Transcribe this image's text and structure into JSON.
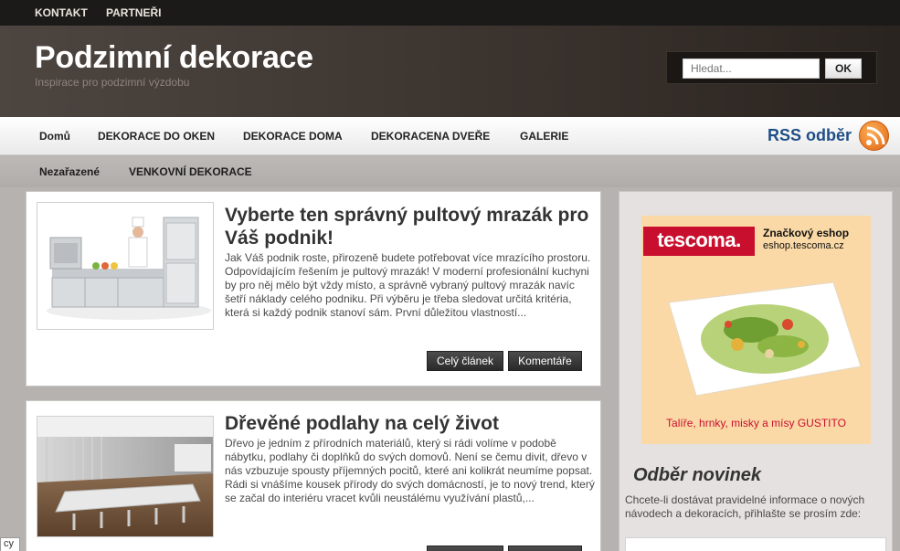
{
  "topnav": {
    "items": [
      "KONTAKT",
      "PARTNEŘI"
    ]
  },
  "header": {
    "title": "Podzimní dekorace",
    "tagline": "Inspirace pro podzimní výzdobu",
    "search_placeholder": "Hledat...",
    "search_button": "OK"
  },
  "mainnav": {
    "items": [
      "Domů",
      "DEKORACE DO OKEN",
      "DEKORACE DOMA",
      "DEKORACENA DVEŘE",
      "GALERIE"
    ],
    "rss_label": "RSS odběr"
  },
  "subnav": {
    "items": [
      "Nezařazené",
      "VENKOVNÍ DEKORACE"
    ]
  },
  "posts": [
    {
      "title": "Vyberte ten správný pultový mrazák pro Váš podnik!",
      "excerpt": "Jak Váš podnik roste, přirozeně budete potřebovat více mrazícího prostoru. Odpovídajícím řešením je pultový mrazák! V moderní profesionální kuchyni by pro něj mělo být vždy místo, a správně vybraný pultový mrazák navíc šetří náklady celého podniku. Při výběru je třeba sledovat určitá kritéria, která si každý podnik stanoví sám. První důležitou vlastností...",
      "read_more": "Celý článek",
      "comments": "Komentáře"
    },
    {
      "title": "Dřevěné podlahy na celý život",
      "excerpt": "Dřevo je jedním z přírodních materiálů, který si rádi volíme v podobě nábytku, podlahy či doplňků do svých domovů. Není se čemu divit, dřevo v nás vzbuzuje spousty příjemných pocitů, které ani kolikrát neumíme popsat. Rádi si vnášíme kousek přírody do svých domácností, je to nový trend, který se začal do interiéru vracet kvůli neustálému využívání plastů,..."
    }
  ],
  "sidebar": {
    "ad": {
      "brand": "tescoma.",
      "headline": "Značkový eshop",
      "url": "eshop.tescoma.cz",
      "footer": "Talíře, hrnky, misky a mísy GUSTITO"
    },
    "newsletter_title": "Odběr novinek",
    "newsletter_text": "Chcete-li dostávat pravidelné informace o nových návodech a dekoracích, přihlašte se prosím zde:"
  },
  "corner_label": "cy",
  "colors": {
    "rss_blue": "#1f4e85",
    "tescoma_red": "#c8102e",
    "header_bg": "#3d3530"
  }
}
